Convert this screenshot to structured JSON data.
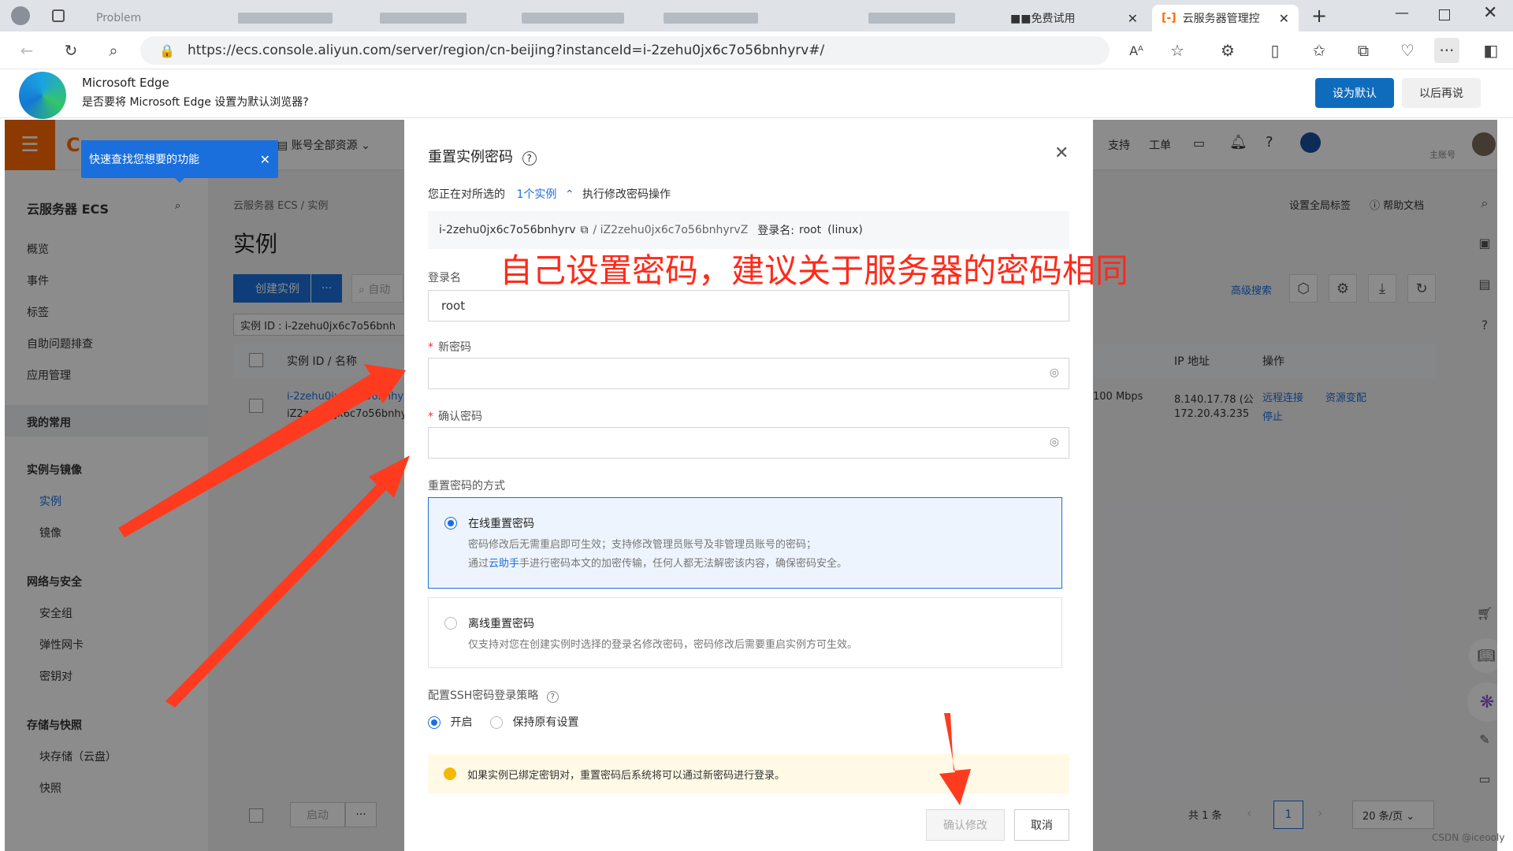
{
  "tabs": {
    "tab1": "Problem",
    "tab_trial": "■■免费试用",
    "tab_active": "云服务器管理控"
  },
  "address": {
    "url": "https://ecs.console.aliyun.com/server/region/cn-beijing?instanceId=i-2zehu0jx6c7o56bnhyrv#/"
  },
  "edge_bar": {
    "title": "Microsoft Edge",
    "message": "是否要将 Microsoft Edge 设置为默认浏览器?",
    "set_default": "设为默认",
    "later": "以后再说"
  },
  "topnav": {
    "account_scope": "账号全部资源",
    "support": "支持",
    "ticket": "工单",
    "main_account": "主账号"
  },
  "tooltip": {
    "text": "快速查找您想要的功能"
  },
  "sidebar": {
    "title": "云服务器 ECS",
    "items": [
      "概览",
      "事件",
      "标签",
      "自助问题排查",
      "应用管理"
    ],
    "favorites": "我的常用",
    "sec_instances": "实例与镜像",
    "instance": "实例",
    "image": "镜像",
    "sec_network": "网络与安全",
    "security_group": "安全组",
    "eni": "弹性网卡",
    "keypair": "密钥对",
    "sec_storage": "存储与快照",
    "block_storage": "块存储（云盘）",
    "snapshot": "快照"
  },
  "main": {
    "breadcrumb": "云服务器 ECS / 实例",
    "page_title": "实例",
    "create_btn": "创建实例",
    "more_btn": "···",
    "search_placeholder": "自动",
    "filter_tag": "实例 ID : i-2zehu0jx6c7o56bnh",
    "global_tags": "设置全局标签",
    "help_docs": "帮助文档",
    "advanced_search": "高级搜索",
    "col_id": "实例 ID / 名称",
    "col_ip": "IP 地址",
    "col_ops": "操作",
    "row_id": "i-2zehu0jx6c7o56bnhyrv",
    "row_name": "iZ2zehu0jx6c7o56bnhyrvZ",
    "bandwidth": "100 Mbps",
    "ip_public": "8.140.17.78 (公",
    "ip_private": "172.20.43.235",
    "remote": "远程连接",
    "resize": "资源变配",
    "stop": "停止",
    "start_btn": "启动",
    "total": "共 1 条",
    "page": "1",
    "page_size": "20 条/页"
  },
  "modal": {
    "title": "重置实例密码",
    "selected_prefix": "您正在对所选的",
    "selected_count": "1个实例",
    "selected_suffix": "执行修改密码操作",
    "instance_id": "i-2zehu0jx6c7o56bnhyrv",
    "instance_name": "/ iZ2zehu0jx6c7o56bnhyrvZ",
    "login_label": "登录名:",
    "login_user": "root",
    "os": "(linux)",
    "annotation": "自己设置密码，建议关于服务器的密码相同",
    "login_name_label": "登录名",
    "login_name_value": "root",
    "new_pwd_label": "新密码",
    "confirm_pwd_label": "确认密码",
    "method_label": "重置密码的方式",
    "online_title": "在线重置密码",
    "online_desc1": "密码修改后无需重启即可生效；支持修改管理员账号及非管理员账号的密码；",
    "online_desc2_a": "通过",
    "online_desc2_link": "云助手",
    "online_desc2_b": "手进行密码本文的加密传输，任何人都无法解密该内容，确保密码安全。",
    "offline_title": "离线重置密码",
    "offline_desc": "仅支持对您在创建实例时选择的登录名修改密码，密码修改后需要重启实例方可生效。",
    "ssh_label": "配置SSH密码登录策略",
    "ssh_on": "开启",
    "ssh_keep": "保持原有设置",
    "notice": "如果实例已绑定密钥对，重置密码后系统将可以通过新密码进行登录。",
    "confirm_btn": "确认修改",
    "cancel_btn": "取消"
  },
  "watermark": "CSDN @iceooly",
  "colors": {
    "accent": "#1a6fdc",
    "annotation_red": "#ff2a1a",
    "brand_orange": "#ff6a00",
    "notice_bg": "#fff9e6"
  }
}
